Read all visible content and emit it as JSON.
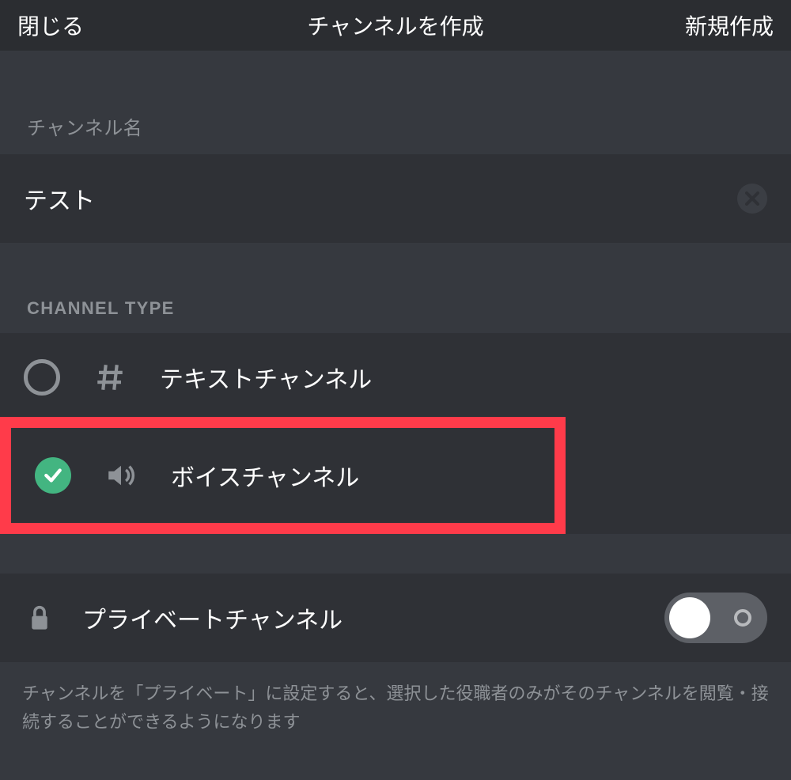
{
  "header": {
    "close_label": "閉じる",
    "title": "チャンネルを作成",
    "create_label": "新規作成"
  },
  "channel_name": {
    "label": "チャンネル名",
    "value": "テスト"
  },
  "channel_type": {
    "label": "CHANNEL TYPE",
    "options": [
      {
        "label": "テキストチャンネル",
        "icon": "hash",
        "selected": false
      },
      {
        "label": "ボイスチャンネル",
        "icon": "speaker",
        "selected": true
      }
    ]
  },
  "private": {
    "label": "プライベートチャンネル",
    "enabled": false,
    "help": "チャンネルを「プライベート」に設定すると、選択した役職者のみがそのチャンネルを閲覧・接続することができるようになります"
  },
  "colors": {
    "accent_green": "#43b581",
    "highlight_red": "#ff3b4a",
    "bg_primary": "#36393f",
    "bg_secondary": "#2f3136",
    "bg_header": "#2b2d31",
    "text_muted": "#8e9297"
  }
}
